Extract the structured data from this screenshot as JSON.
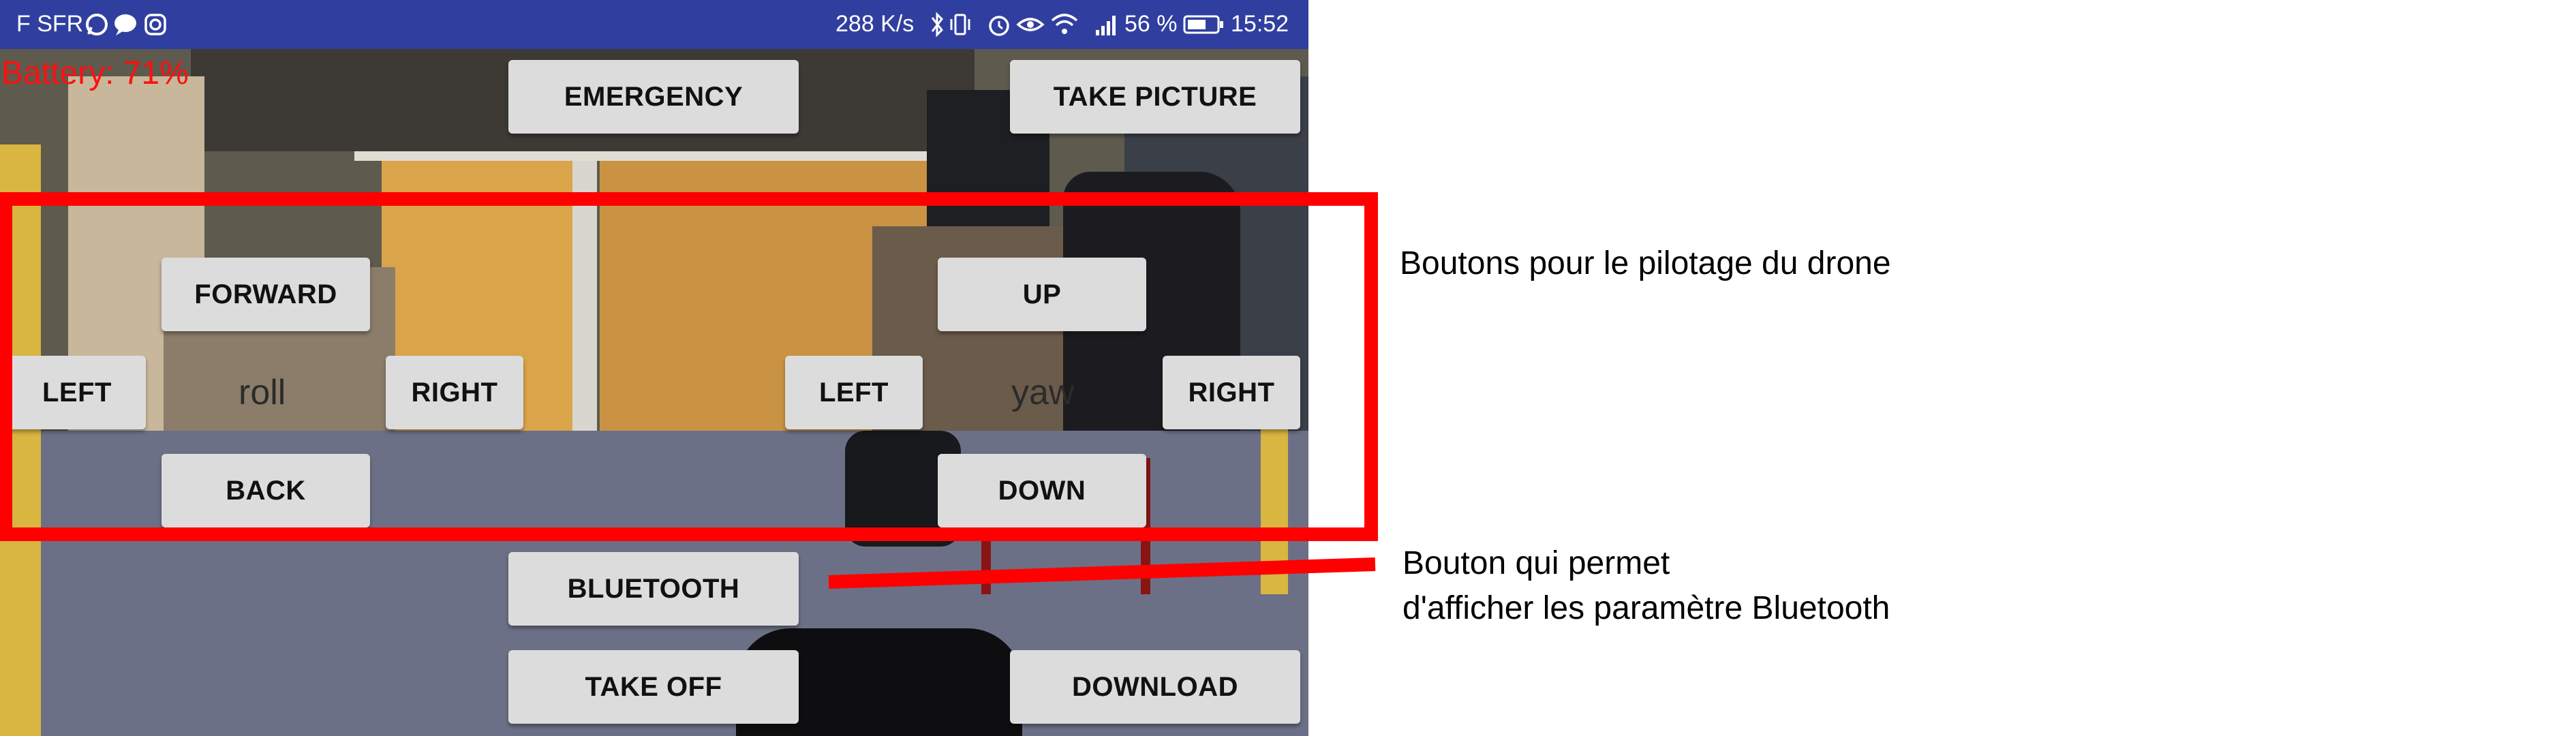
{
  "status_bar": {
    "carrier": "F SFR",
    "speed": "288 K/s",
    "battery_pct": "56 %",
    "time": "15:52",
    "left_icons": [
      "whatsapp-icon",
      "message-icon",
      "instagram-icon"
    ],
    "right_icons": [
      "bluetooth-icon",
      "vibrate-icon",
      "alarm-icon",
      "eye-icon",
      "wifi-icon",
      "signal-icon",
      "battery-icon"
    ]
  },
  "drone": {
    "battery_label": "Battery: 71%",
    "buttons": {
      "emergency": "EMERGENCY",
      "take_picture": "TAKE PICTURE",
      "forward": "FORWARD",
      "back": "BACK",
      "roll_left": "LEFT",
      "roll_right": "RIGHT",
      "up": "UP",
      "down": "DOWN",
      "yaw_left": "LEFT",
      "yaw_right": "RIGHT",
      "bluetooth": "BLUETOOTH",
      "take_off": "TAKE OFF",
      "download": "DOWNLOAD"
    },
    "roll_label": "roll",
    "yaw_label": "yaw"
  },
  "annotations": {
    "controls_note": "Boutons pour le pilotage du drone",
    "bluetooth_note_line1": "Bouton qui permet",
    "bluetooth_note_line2": "d'afficher les paramètre Bluetooth"
  },
  "colors": {
    "status_bar": "#303f9f",
    "battery_text": "#ff1010",
    "button_bg": "#dcdcdc",
    "annotation": "#ff0000"
  }
}
